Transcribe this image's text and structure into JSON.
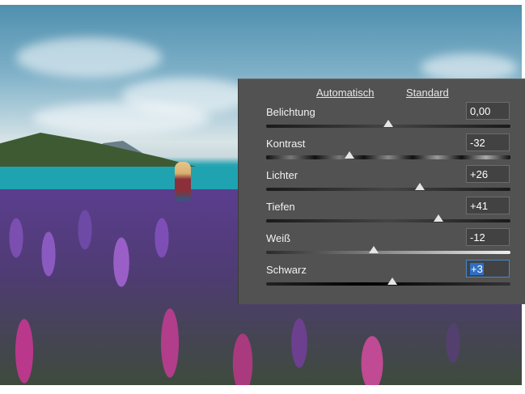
{
  "panel": {
    "auto_label": "Automatisch",
    "standard_label": "Standard",
    "sliders": [
      {
        "label": "Belichtung",
        "value": "0,00",
        "level": 0.5,
        "style": "plain"
      },
      {
        "label": "Kontrast",
        "value": "-32",
        "level": 0.34,
        "style": "contrast"
      },
      {
        "label": "Lichter",
        "value": "+26",
        "level": 0.63,
        "style": "plain"
      },
      {
        "label": "Tiefen",
        "value": "+41",
        "level": 0.705,
        "style": "plain"
      },
      {
        "label": "Weiß",
        "value": "-12",
        "level": 0.44,
        "style": "light"
      },
      {
        "label": "Schwarz",
        "value": "+3",
        "level": 0.515,
        "style": "dark"
      }
    ]
  }
}
